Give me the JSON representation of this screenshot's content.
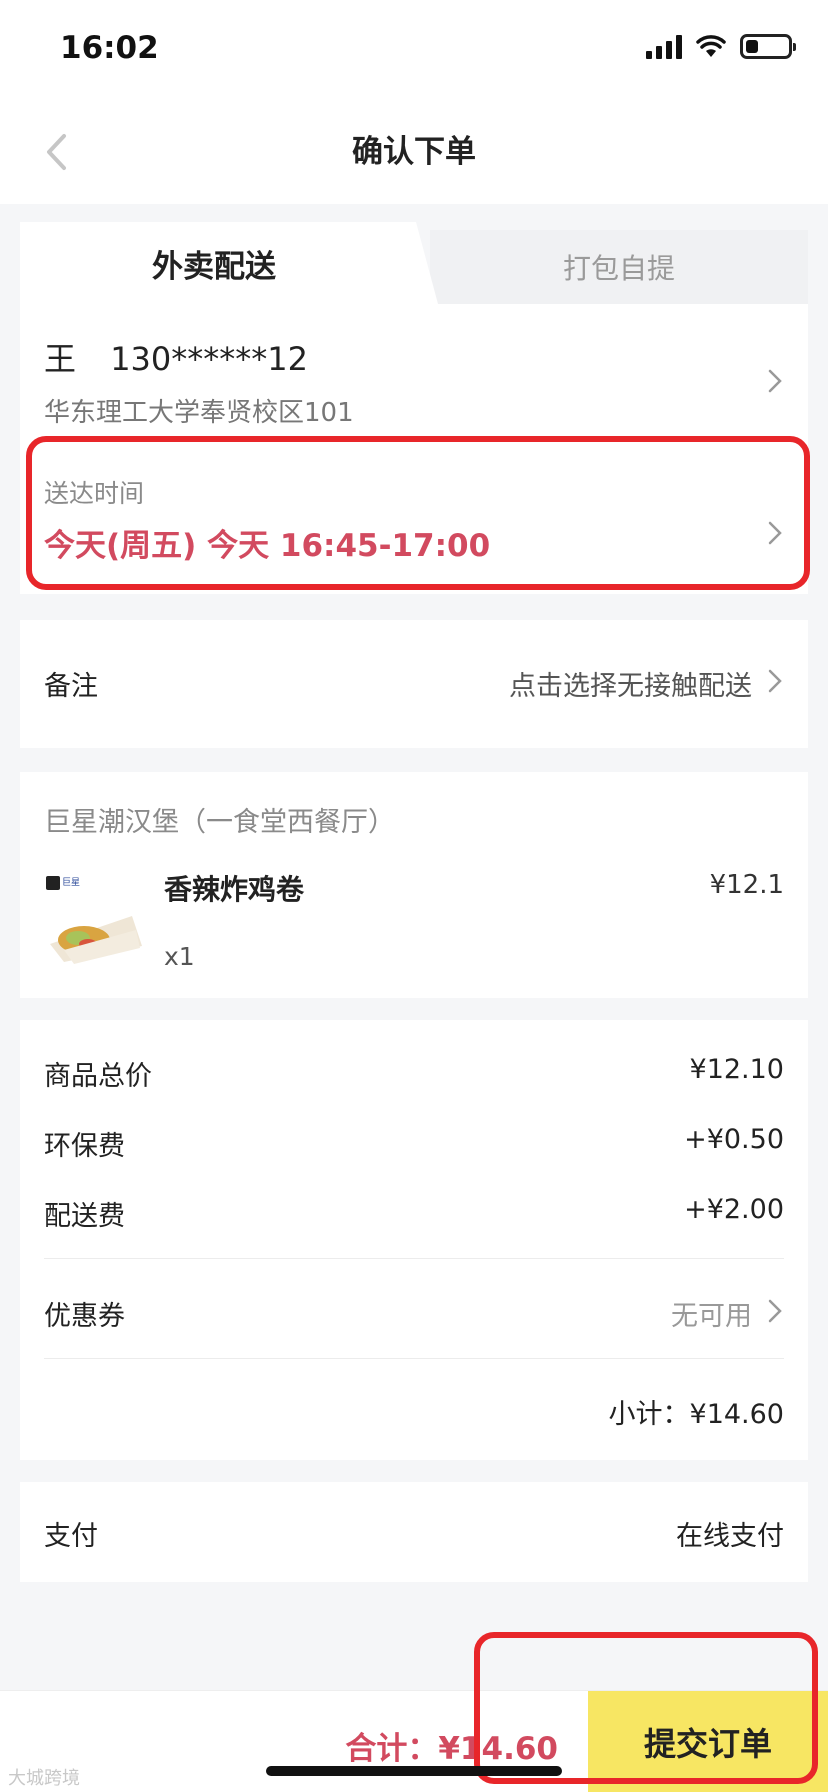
{
  "status_bar": {
    "time": "16:02",
    "battery_level": 0.3
  },
  "nav": {
    "title": "确认下单"
  },
  "tabs": {
    "delivery": "外卖配送",
    "pickup": "打包自提",
    "active": "delivery"
  },
  "address": {
    "name": "王",
    "phone": "130******12",
    "address": "华东理工大学奉贤校区101"
  },
  "delivery_time": {
    "label": "送达时间",
    "value": "今天(周五) 今天 16:45-17:00"
  },
  "remark": {
    "label": "备注",
    "value": "点击选择无接触配送"
  },
  "shop": {
    "name": "巨星潮汉堡（一食堂西餐厅）",
    "product": {
      "name": "香辣炸鸡卷",
      "qty": "x1",
      "price": "¥12.1",
      "thumb_brand": "巨星"
    }
  },
  "pricing": {
    "items_total_label": "商品总价",
    "items_total": "¥12.10",
    "eco_fee_label": "环保费",
    "eco_fee": "+¥0.50",
    "delivery_fee_label": "配送费",
    "delivery_fee": "+¥2.00",
    "coupon_label": "优惠券",
    "coupon_value": "无可用",
    "subtotal": "小计：¥14.60"
  },
  "payment": {
    "label": "支付",
    "value": "在线支付"
  },
  "bottom": {
    "total": "合计：¥14.60",
    "submit": "提交订单"
  },
  "watermark": "大城跨境",
  "colors": {
    "accent_red": "#d24a5f",
    "submit_yellow": "#f7e663",
    "highlight_red": "#e8262a"
  }
}
